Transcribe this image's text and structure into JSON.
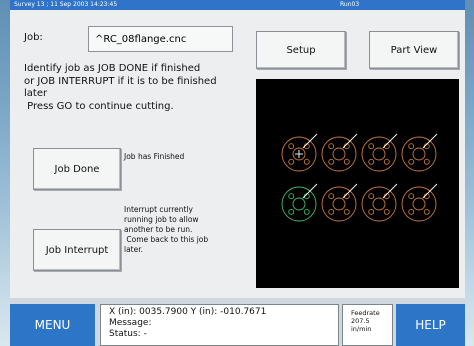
{
  "titlebar": {
    "left": "Survey 13 ; 11 Sep 2003 14:23:45",
    "right": "Run03"
  },
  "job": {
    "label": "Job:",
    "value": "^RC_08flange.cnc"
  },
  "buttons": {
    "setup": "Setup",
    "part_view": "Part View",
    "job_done": "Job Done",
    "job_interrupt": "Job Interrupt"
  },
  "instructions": {
    "line1": "Identify job as JOB DONE if finished",
    "line2": "or JOB INTERRUPT if it is to be finished",
    "line3": "later",
    "line4": " Press GO to continue cutting."
  },
  "done_desc": "Job has Finished",
  "interrupt_desc": {
    "line1": "Interrupt currently",
    "line2": "running job to allow",
    "line3": "another to be run.",
    "line4": " Come back to this job",
    "line5": "later."
  },
  "bottom": {
    "menu": "MENU",
    "help": "HELP"
  },
  "status": {
    "coords": "X (in): 0035.7900    Y (in): -010.7671",
    "message": "Message:",
    "status": "Status:  -"
  },
  "feedrate": {
    "label": "Feedrate",
    "value": "207.5",
    "unit": "in/min"
  },
  "colors": {
    "accent": "#2d76c7",
    "preview_bg": "#000000",
    "part_orange": "#c87a3a",
    "part_green": "#3fbf62",
    "part_white": "#ffffff"
  }
}
